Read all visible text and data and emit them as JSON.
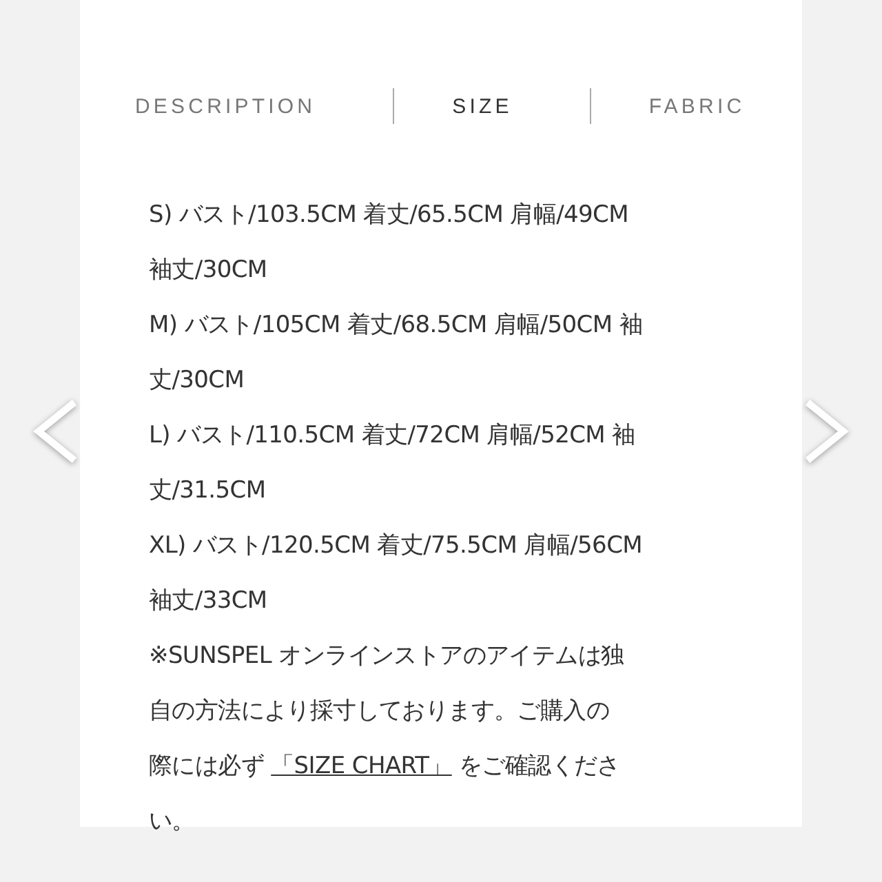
{
  "tabs": [
    {
      "label": "DESCRIPTION",
      "selected": false
    },
    {
      "label": "SIZE",
      "selected": true
    },
    {
      "label": "FABRIC",
      "selected": false
    }
  ],
  "size_text": [
    {
      "lines": [
        {
          "text": "S) バスト/103.5CM 着丈/65.5CM 肩幅/49CM"
        },
        {
          "text": "袖丈/30CM"
        }
      ]
    },
    {
      "lines": [
        {
          "text": "M) バスト/105CM 着丈/68.5CM 肩幅/50CM 袖"
        },
        {
          "text": "丈/30CM"
        }
      ]
    },
    {
      "lines": [
        {
          "text": "L) バスト/110.5CM 着丈/72CM 肩幅/52CM 袖"
        },
        {
          "text": "丈/31.5CM"
        }
      ]
    },
    {
      "lines": [
        {
          "text": "XL) バスト/120.5CM 着丈/75.5CM 肩幅/56CM"
        },
        {
          "text": "袖丈/33CM"
        }
      ]
    },
    {
      "lines": [
        {
          "text": "※SUNSPEL オンラインストアのアイテムは独"
        },
        {
          "text": "自の方法により採寸しております。ご購入の"
        },
        {
          "text": "際には必ず ",
          "link": "「SIZE CHART」",
          "after": " をご確認くださ"
        },
        {
          "text": "い。"
        }
      ]
    }
  ]
}
